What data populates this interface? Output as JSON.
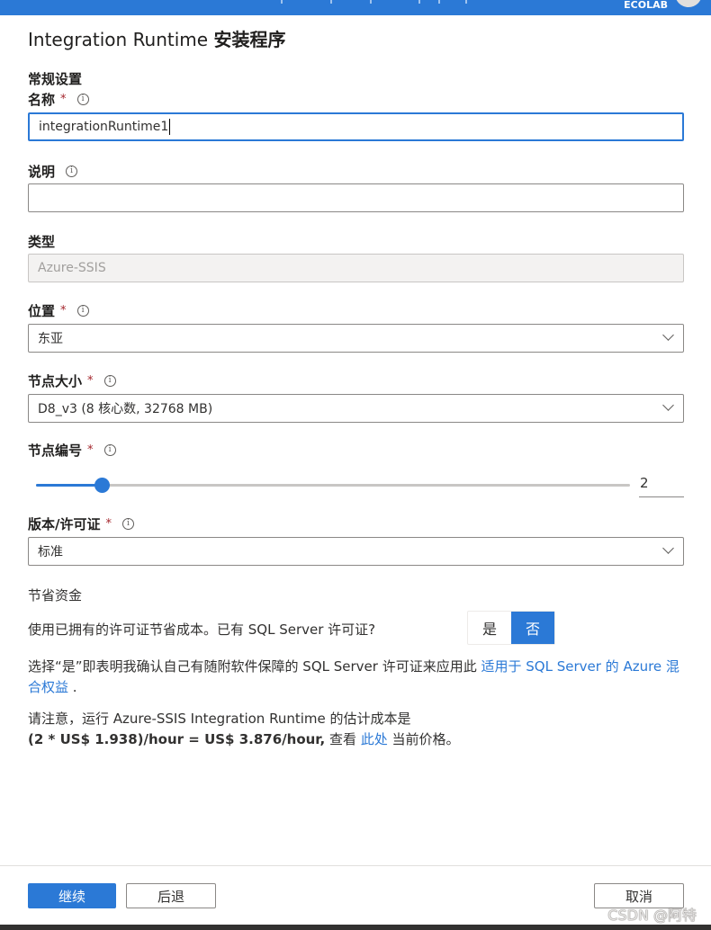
{
  "topbar": {
    "org": "ECOLAB"
  },
  "panel": {
    "title_en": "Integration Runtime ",
    "title_cn": "安装程序"
  },
  "general": {
    "section": "常规设置",
    "name": {
      "label": "名称",
      "required": "*",
      "value": "integrationRuntime1"
    },
    "description": {
      "label": "说明",
      "value": ""
    },
    "type": {
      "label": "类型",
      "value": "Azure-SSIS"
    },
    "location": {
      "label": "位置",
      "required": "*",
      "value": "东亚"
    },
    "node_size": {
      "label": "节点大小",
      "required": "*",
      "value": "D8_v3 (8 核心数, 32768 MB)"
    },
    "node_count": {
      "label": "节点编号",
      "required": "*",
      "value": "2",
      "slider_fraction": 0.11
    },
    "edition": {
      "label": "版本/许可证",
      "required": "*",
      "value": "标准"
    }
  },
  "savings": {
    "heading": "节省资金",
    "question": "使用已拥有的许可证节省成本。已有 SQL Server 许可证?",
    "yes": "是",
    "no": "否",
    "selected": "否",
    "note_prefix": "选择“是”即表明我确认自己有随附软件保障的 SQL Server 许可证来应用此 ",
    "note_link": "适用于 SQL Server 的 Azure 混合权益",
    "note_suffix": " .",
    "cost_line1": "请注意，运行 Azure-SSIS Integration Runtime 的估计成本是",
    "cost_bold": "(2 * US$ 1.938)/hour = US$ 3.876/hour,",
    "cost_see": " 查看 ",
    "cost_link": "此处",
    "cost_suffix": " 当前价格。"
  },
  "footer": {
    "continue": "继续",
    "back": "后退",
    "cancel": "取消"
  },
  "watermark": "CSDN @阿特",
  "colors": {
    "accent": "#2b79d6",
    "required": "#a4262c"
  }
}
